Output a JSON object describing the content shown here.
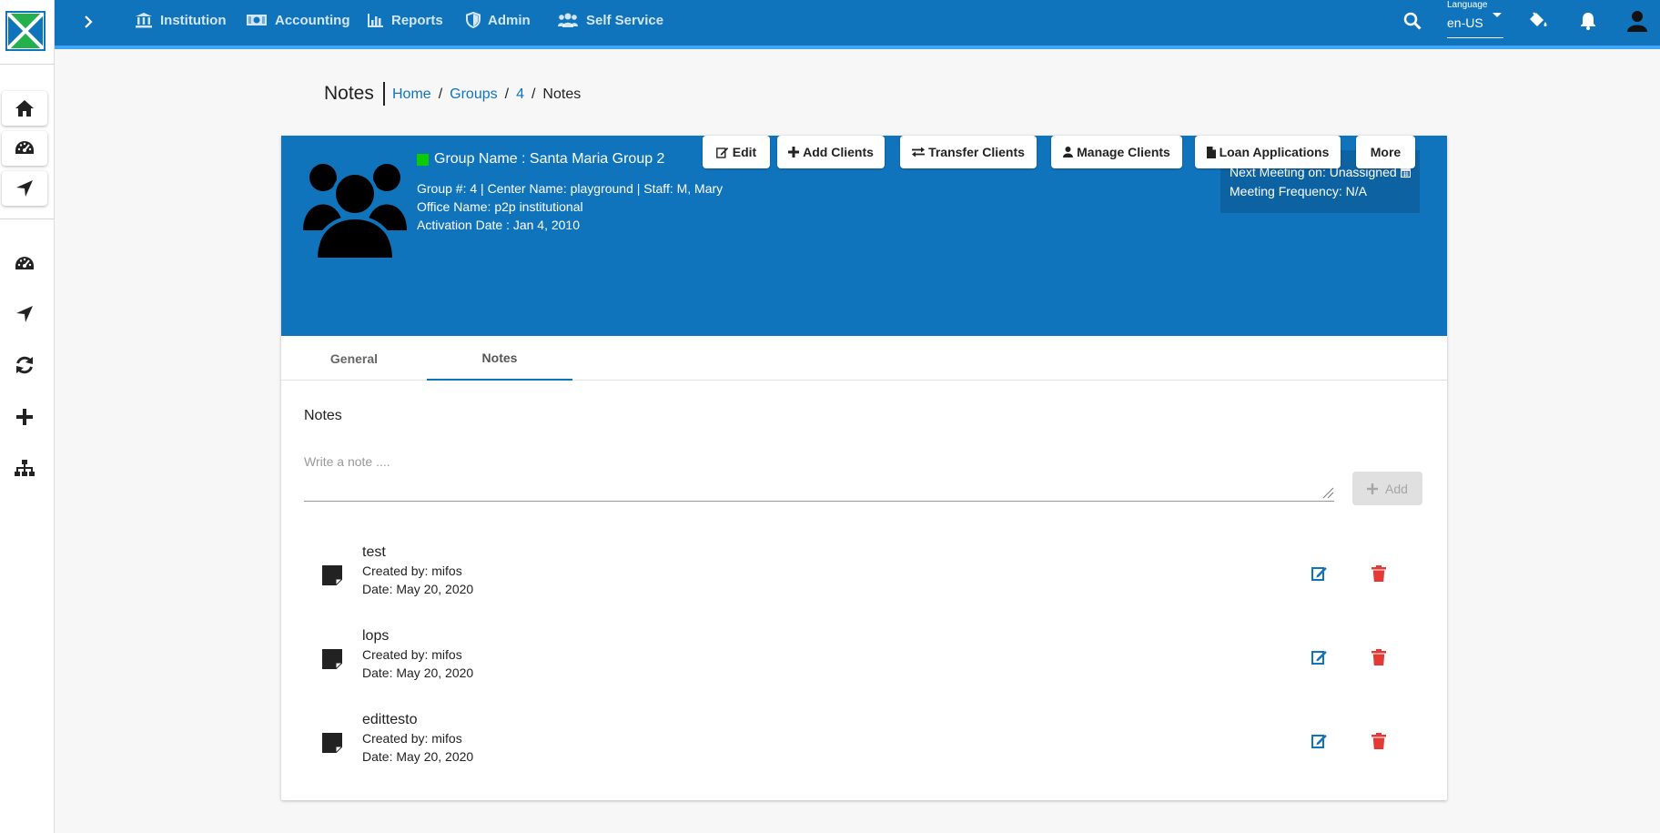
{
  "nav": {
    "items": [
      {
        "label": "Institution",
        "icon": "institution-icon"
      },
      {
        "label": "Accounting",
        "icon": "money-icon"
      },
      {
        "label": "Reports",
        "icon": "bar-chart-icon"
      },
      {
        "label": "Admin",
        "icon": "shield-icon"
      },
      {
        "label": "Self Service",
        "icon": "users-icon"
      }
    ],
    "language_label": "Language",
    "language_value": "en-US"
  },
  "breadcrumb": {
    "title": "Notes",
    "items": [
      "Home",
      "Groups",
      "4"
    ],
    "current": "Notes"
  },
  "group": {
    "name": "Group Name : Santa Maria Group 2",
    "status_color": "#0ccb00",
    "line1": "Group #: 4 | Center Name: playground | Staff: M, Mary",
    "office": "Office Name: p2p institutional",
    "activation": "Activation Date : Jan 4, 2010",
    "next_meeting": "Next Meeting on: Unassigned",
    "meeting_frequency": "Meeting Frequency: N/A"
  },
  "actions": {
    "edit": "Edit",
    "add_clients": "Add Clients",
    "transfer_clients": "Transfer Clients",
    "manage_clients": "Manage Clients",
    "loan_applications": "Loan Applications",
    "more": "More"
  },
  "tabs": [
    "General",
    "Notes"
  ],
  "notes": {
    "title": "Notes",
    "placeholder": "Write a note ....",
    "add_label": "Add",
    "items": [
      {
        "title": "test",
        "created_by": "Created by: mifos",
        "date": "Date: May 20, 2020"
      },
      {
        "title": "lops",
        "created_by": "Created by: mifos",
        "date": "Date: May 20, 2020"
      },
      {
        "title": "edittesto",
        "created_by": "Created by: mifos",
        "date": "Date: May 20, 2020"
      }
    ]
  },
  "colors": {
    "primary": "#1074bc",
    "accent_bar": "#42a5f5",
    "delete": "#e53935"
  }
}
